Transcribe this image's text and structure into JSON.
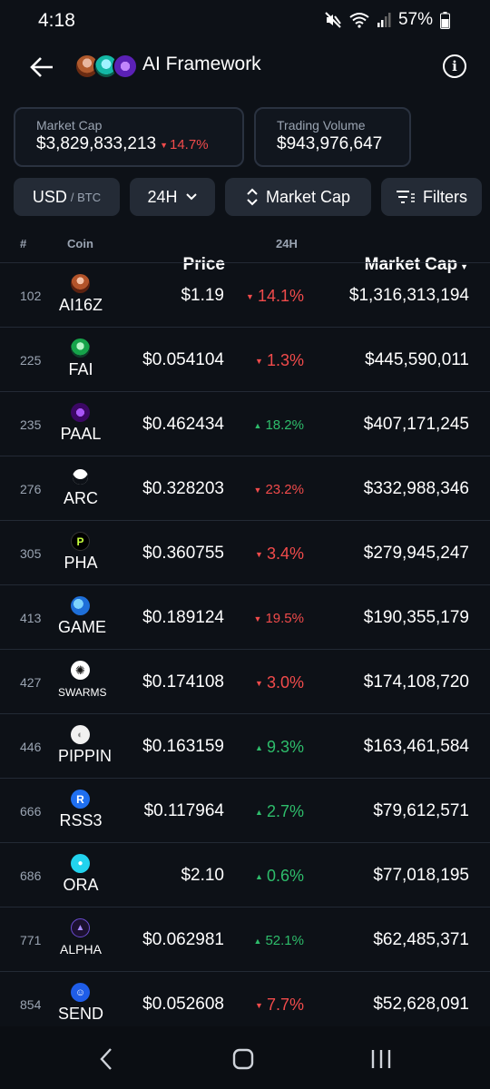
{
  "status": {
    "time": "4:18",
    "battery": "57%",
    "icons": [
      "mute-icon",
      "wifi-icon",
      "signal-icon",
      "battery-icon"
    ]
  },
  "header": {
    "title": "AI Framework",
    "avatars": [
      "ai16z-avatar",
      "fai-avatar",
      "paal-avatar"
    ]
  },
  "stats": {
    "market_cap_label": "Market Cap",
    "market_cap_value": "$3,829,833,213",
    "market_cap_change": "14.7%",
    "trading_volume_label": "Trading Volume",
    "trading_volume_value": "$943,976,647"
  },
  "filters": {
    "currency": "USD",
    "currency_alt": "/ BTC",
    "range": "24H",
    "sort": "Market Cap",
    "filters": "Filters"
  },
  "table": {
    "headers": {
      "num": "#",
      "coin": "Coin",
      "price": "Price",
      "change": "24H",
      "mcap": "Market Cap"
    },
    "rows": [
      {
        "rank": "102",
        "symbol": "AI16Z",
        "price": "$1.19",
        "change": "14.1%",
        "mcap": "$1,316,313,194"
      },
      {
        "rank": "225",
        "symbol": "FAI",
        "price": "$0.054104",
        "change": "1.3%",
        "mcap": "$445,590,011"
      },
      {
        "rank": "235",
        "symbol": "PAAL",
        "price": "$0.462434",
        "change": "18.2%",
        "mcap": "$407,171,245"
      },
      {
        "rank": "276",
        "symbol": "ARC",
        "price": "$0.328203",
        "change": "23.2%",
        "mcap": "$332,988,346"
      },
      {
        "rank": "305",
        "symbol": "PHA",
        "price": "$0.360755",
        "change": "3.4%",
        "mcap": "$279,945,247"
      },
      {
        "rank": "413",
        "symbol": "GAME",
        "price": "$0.189124",
        "change": "19.5%",
        "mcap": "$190,355,179"
      },
      {
        "rank": "427",
        "symbol": "SWARMS",
        "price": "$0.174108",
        "change": "3.0%",
        "mcap": "$174,108,720"
      },
      {
        "rank": "446",
        "symbol": "PIPPIN",
        "price": "$0.163159",
        "change": "9.3%",
        "mcap": "$163,461,584"
      },
      {
        "rank": "666",
        "symbol": "RSS3",
        "price": "$0.117964",
        "change": "2.7%",
        "mcap": "$79,612,571"
      },
      {
        "rank": "686",
        "symbol": "ORA",
        "price": "$2.10",
        "change": "0.6%",
        "mcap": "$77,018,195"
      },
      {
        "rank": "771",
        "symbol": "ALPHA",
        "price": "$0.062981",
        "change": "52.1%",
        "mcap": "$62,485,371"
      },
      {
        "rank": "854",
        "symbol": "SEND",
        "price": "$0.052608",
        "change": "7.7%",
        "mcap": "$52,628,091"
      }
    ]
  },
  "colors": {
    "background": "#0d1117",
    "up": "#2ebd6b",
    "down": "#f14b4b",
    "muted": "#9aa4b2",
    "button": "#242b36"
  }
}
